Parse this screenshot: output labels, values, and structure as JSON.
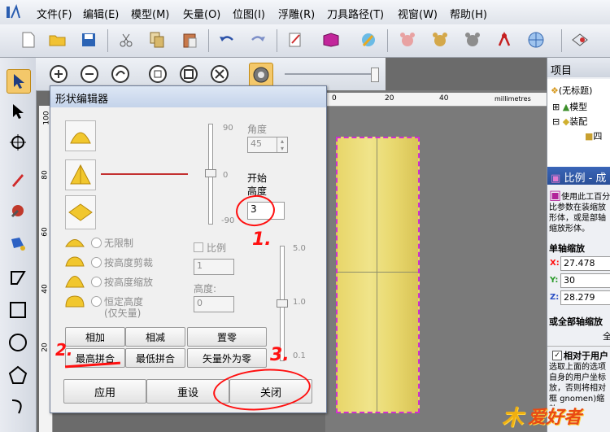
{
  "menu": [
    "文件(F)",
    "编辑(E)",
    "模型(M)",
    "矢量(O)",
    "位图(I)",
    "浮雕(R)",
    "刀具路径(T)",
    "视窗(W)",
    "帮助(H)"
  ],
  "dialog": {
    "title": "形状编辑器",
    "angle_label": "角度",
    "angle_value": "45",
    "start_height_label_1": "开始",
    "start_height_label_2": "高度",
    "start_height_value": "3",
    "slider_left_ticks": [
      "90",
      "0",
      "-90"
    ],
    "slider_right_ticks": [
      "5.0",
      "1.0",
      "0.1"
    ],
    "radio_unlimited": "无限制",
    "radio_clip": "按高度剪裁",
    "radio_scale": "按高度缩放",
    "radio_const_1": "恒定高度",
    "radio_const_2": "(仅矢量)",
    "ratio_label": "比例",
    "ratio_value": "1",
    "height_label": "高度:",
    "height_value": "0",
    "btn_add": "相加",
    "btn_sub": "相减",
    "btn_zero": "置零",
    "btn_merge_high": "最高拼合",
    "btn_merge_low": "最低拼合",
    "btn_vec_zero": "矢量外为零",
    "btn_apply": "应用",
    "btn_reset": "重设",
    "btn_close": "关闭"
  },
  "annotations": {
    "n1": "1.",
    "n2": "2.",
    "n3": "3."
  },
  "ruler": {
    "top_ticks": [
      "0",
      "20",
      "40"
    ],
    "unit": "millimetres",
    "left_ticks": [
      "100",
      "80",
      "60",
      "40",
      "20"
    ]
  },
  "right_panel": {
    "project": "项目",
    "untitled": "(无标题)",
    "model": "模型",
    "assembly": "装配",
    "sub": "四",
    "scale_title": "比例 - 成",
    "desc": "使用此工百分比参数在装缩放形体，或是部轴缩放形体。",
    "single_axis": "单轴缩放",
    "x_label": "X:",
    "x_value": "27.478",
    "y_label": "Y:",
    "y_value": "30",
    "z_label": "Z:",
    "z_value": "28.279",
    "all_axis": "或全部轴缩放",
    "all_char": "全",
    "relative": "相对于用户",
    "relative_desc": "选取上面的选项自身的用户坐标放，否则将相对框 gnomen)缩放"
  },
  "watermark": "爱好者",
  "colors": {
    "accent": "#ff1010",
    "shape": "#ecdc76",
    "selection": "#d12fd1"
  }
}
